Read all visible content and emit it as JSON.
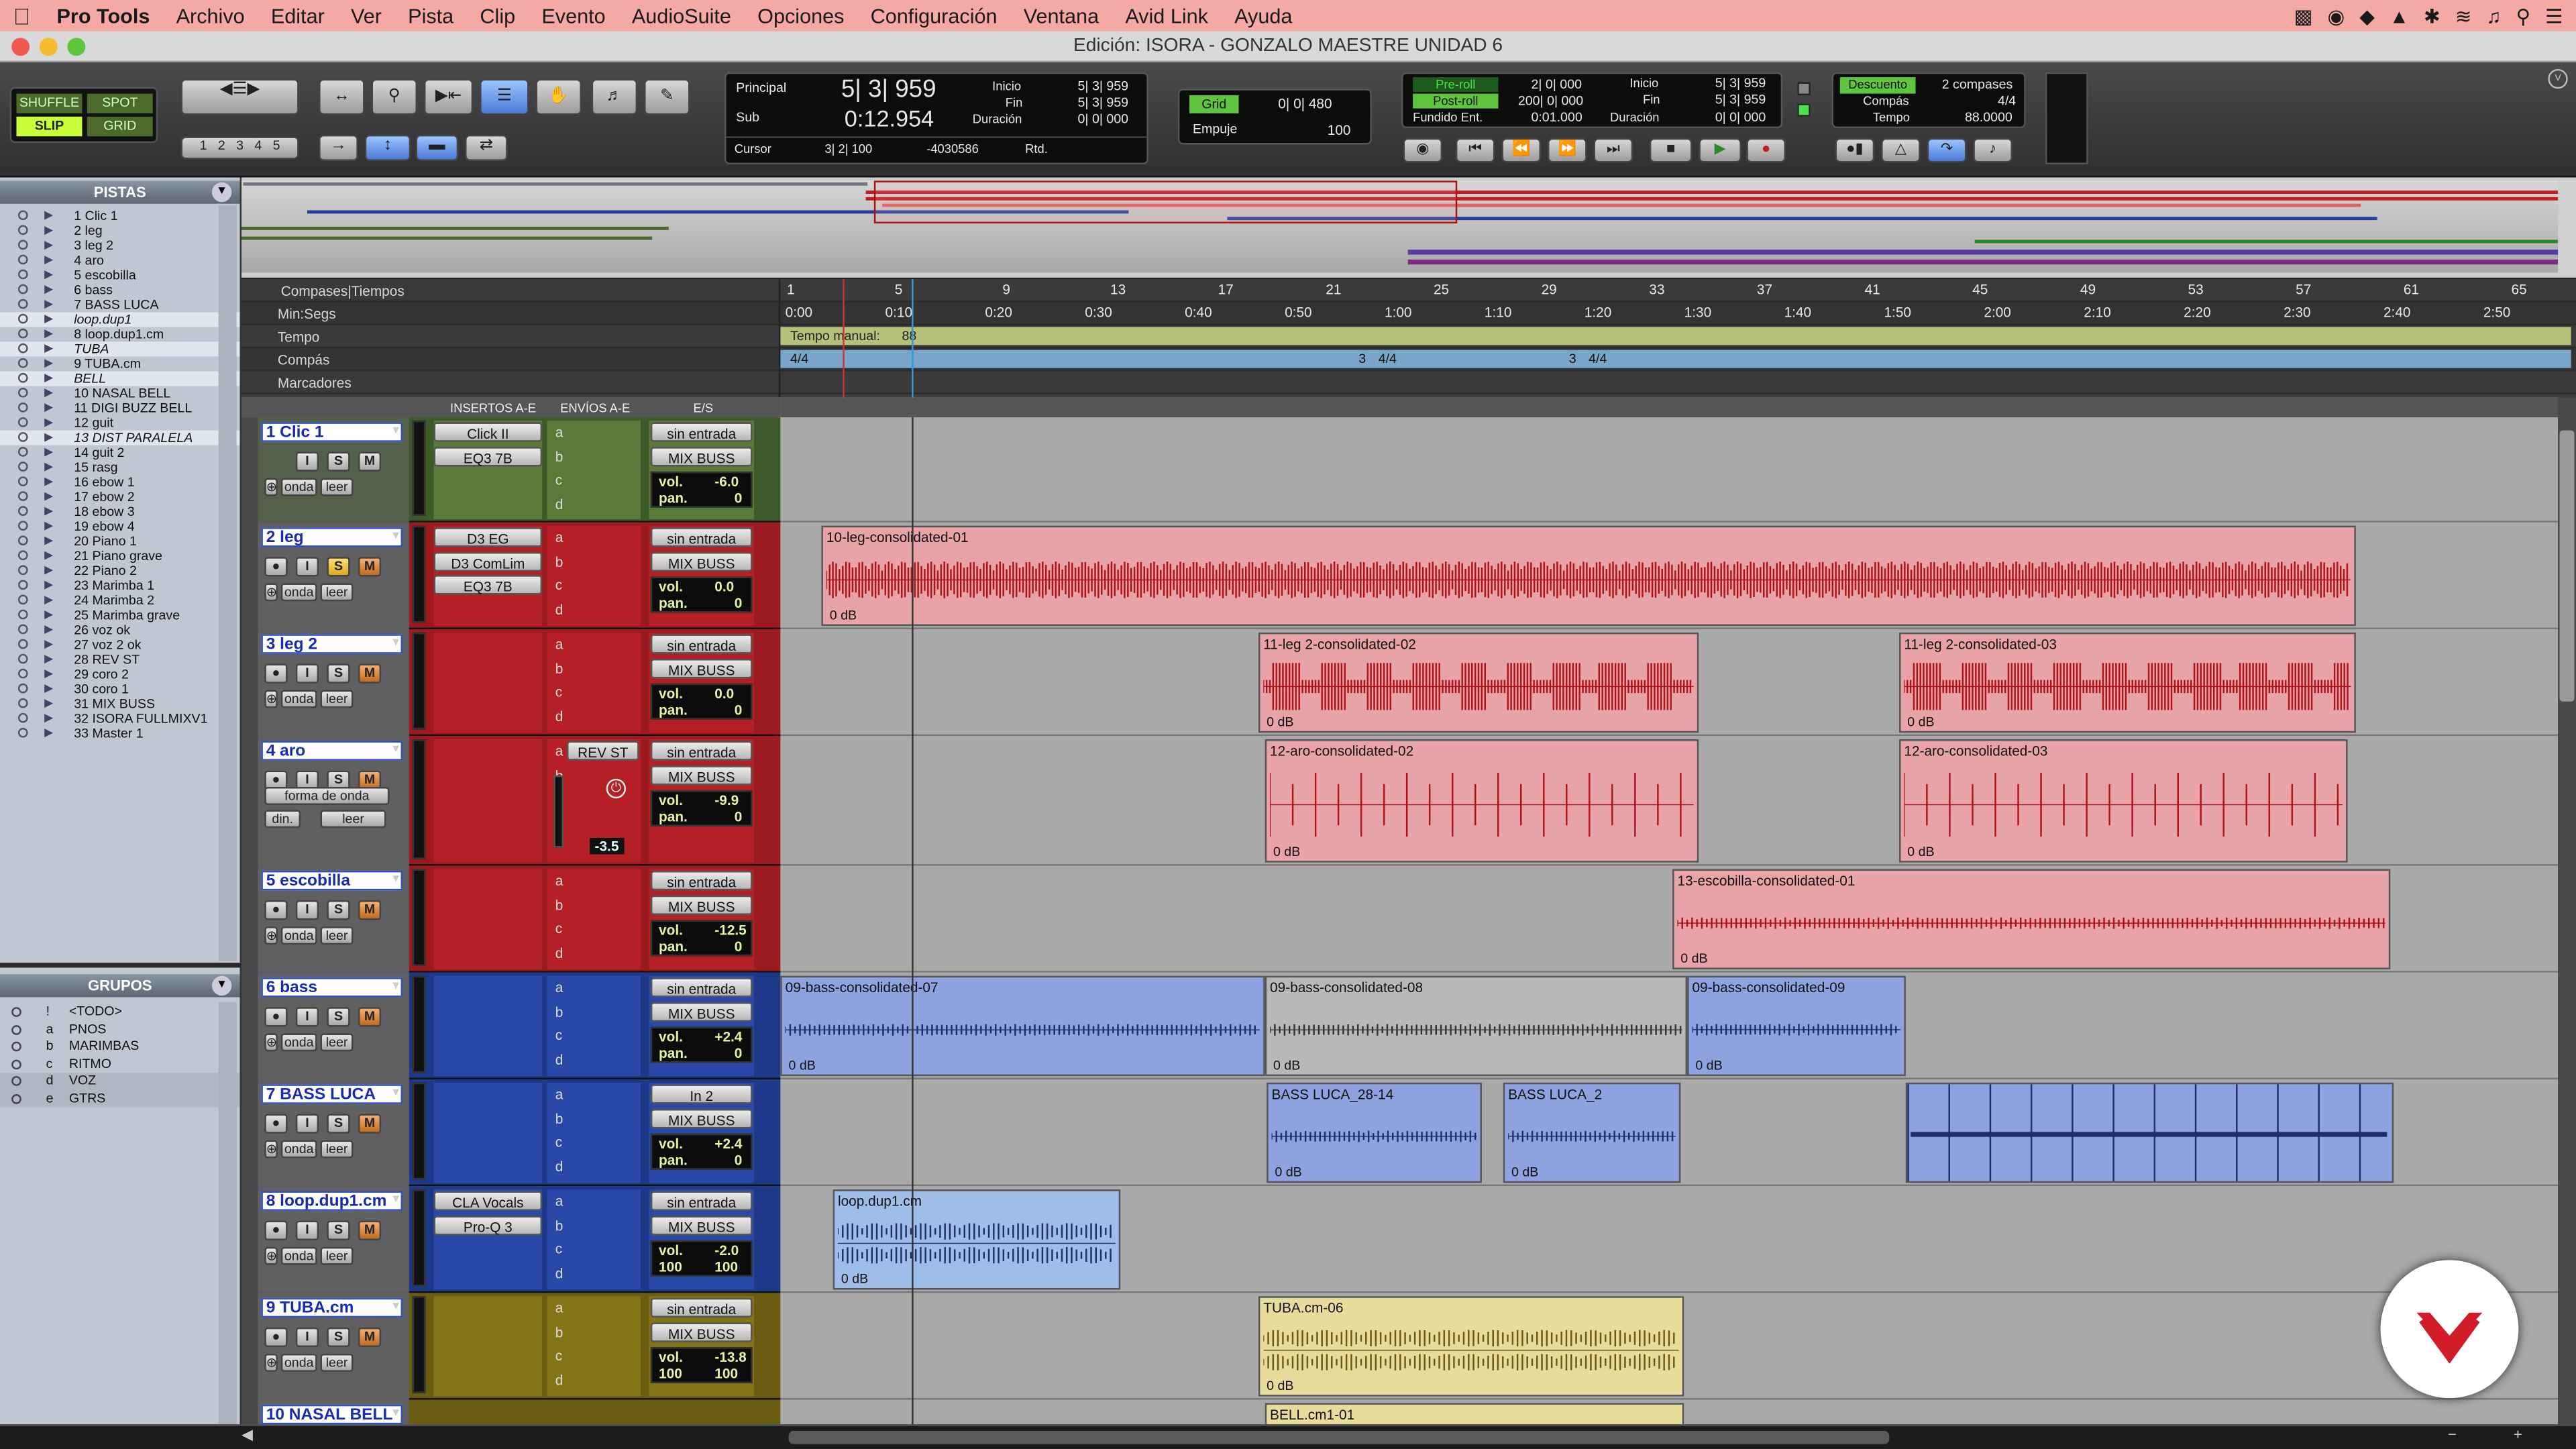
{
  "menubar": {
    "apple": "",
    "app": "Pro Tools",
    "items": [
      "Archivo",
      "Editar",
      "Ver",
      "Pista",
      "Clip",
      "Evento",
      "AudioSuite",
      "Opciones",
      "Configuración",
      "Ventana",
      "Avid Link",
      "Ayuda"
    ]
  },
  "window": {
    "title": "Edición: ISORA - GONZALO MAESTRE UNIDAD 6"
  },
  "toolbar": {
    "modes": {
      "shuffle": "SHUFFLE",
      "spot": "SPOT",
      "slip": "SLIP",
      "grid": "GRID"
    },
    "zoom_presets": [
      "1",
      "2",
      "3",
      "4",
      "5"
    ],
    "counter": {
      "main_label": "Principal",
      "main_value": "5| 3| 959",
      "sub_label": "Sub",
      "sub_value": "0:12.954",
      "cursor_label": "Cursor",
      "cursor_value": "3| 2| 100",
      "cursor_sample": "-4030586",
      "start_label": "Inicio",
      "start_value": "5| 3| 959",
      "end_label": "Fin",
      "end_value": "5| 3| 959",
      "length_label": "Duración",
      "length_value": "0| 0| 000",
      "ritd": "Rtd."
    },
    "grid": {
      "label": "Grid",
      "value": "0| 0| 480",
      "nudge_label": "Empuje",
      "nudge_value": "100"
    },
    "transport": {
      "preroll_label": "Pre-roll",
      "preroll_value": "2| 0| 000",
      "postroll_label": "Post-roll",
      "postroll_value": "200| 0| 000",
      "fade_label": "Fundido Ent.",
      "fade_value": "0:01.000",
      "start_label": "Inicio",
      "start_value": "5| 3| 959",
      "end_label": "Fin",
      "end_value": "5| 3| 959",
      "length_label": "Duración",
      "length_value": "0| 0| 000"
    },
    "countoff": {
      "label": "Descuento",
      "value": "2 compases",
      "meter_label": "Compás",
      "meter_value": "4/4",
      "tempo_label": "Tempo",
      "tempo_value": "88.0000"
    }
  },
  "tracks_panel": {
    "title": "PISTAS",
    "items": [
      {
        "label": "1  Clic 1"
      },
      {
        "label": "2  leg"
      },
      {
        "label": "3  leg 2"
      },
      {
        "label": "4  aro"
      },
      {
        "label": "5  escobilla"
      },
      {
        "label": "6  bass"
      },
      {
        "label": "7  BASS LUCA"
      },
      {
        "label": "loop.dup1",
        "italic": true
      },
      {
        "label": "8  loop.dup1.cm"
      },
      {
        "label": "TUBA",
        "italic": true
      },
      {
        "label": "9  TUBA.cm"
      },
      {
        "label": "BELL",
        "italic": true
      },
      {
        "label": "10  NASAL BELL"
      },
      {
        "label": "11  DIGI BUZZ BELL"
      },
      {
        "label": "12  guit"
      },
      {
        "label": "13  DIST PARALELA",
        "italic": true
      },
      {
        "label": "14  guit 2"
      },
      {
        "label": "15  rasg"
      },
      {
        "label": "16  ebow 1"
      },
      {
        "label": "17  ebow 2"
      },
      {
        "label": "18  ebow 3"
      },
      {
        "label": "19  ebow 4"
      },
      {
        "label": "20  Piano 1"
      },
      {
        "label": "21  Piano grave"
      },
      {
        "label": "22  Piano 2"
      },
      {
        "label": "23  Marimba 1"
      },
      {
        "label": "24  Marimba 2"
      },
      {
        "label": "25  Marimba grave"
      },
      {
        "label": "26  voz ok"
      },
      {
        "label": "27  voz 2 ok"
      },
      {
        "label": "28  REV ST"
      },
      {
        "label": "29  coro 2"
      },
      {
        "label": "30  coro 1"
      },
      {
        "label": "31  MIX BUSS"
      },
      {
        "label": "32  ISORA FULLMIXV1"
      },
      {
        "label": "33  Master 1"
      }
    ]
  },
  "groups_panel": {
    "title": "GRUPOS",
    "items": [
      {
        "id": "!",
        "label": "<TODO>"
      },
      {
        "id": "a",
        "label": "PNOS"
      },
      {
        "id": "b",
        "label": "MARIMBAS"
      },
      {
        "id": "c",
        "label": "RITMO"
      },
      {
        "id": "d",
        "label": "VOZ"
      },
      {
        "id": "e",
        "label": "GTRS"
      }
    ]
  },
  "ruler": {
    "bars_label": "Compases|Tiempos",
    "minsec_label": "Min:Segs",
    "tempo_label": "Tempo",
    "meter_label": "Compás",
    "markers_label": "Marcadores",
    "bar_ticks": [
      "1",
      "5",
      "9",
      "13",
      "17",
      "21",
      "25",
      "29",
      "33",
      "37",
      "41",
      "45",
      "49",
      "53",
      "57",
      "61",
      "65"
    ],
    "time_ticks": [
      "0:00",
      "0:10",
      "0:20",
      "0:30",
      "0:40",
      "0:50",
      "1:00",
      "1:10",
      "1:20",
      "1:30",
      "1:40",
      "1:50",
      "2:00",
      "2:10",
      "2:20",
      "2:30",
      "2:40",
      "2:50"
    ],
    "tempo_text": "Tempo manual:",
    "tempo_value": "88",
    "meter_start": "4/4",
    "meter_change1": "3",
    "meter_change1b": "4/4",
    "meter_change2": "3",
    "meter_change2b": "4/4"
  },
  "col_headers": {
    "inserts": "INSERTOS A-E",
    "sends": "ENVÍOS A-E",
    "io": "E/S"
  },
  "common": {
    "sin_entrada": "sin entrada",
    "mix_buss": "MIX BUSS",
    "vol": "vol.",
    "pan": "pan.",
    "onda": "onda",
    "leer": "leer",
    "db0": "0 dB",
    "forma": "forma de onda",
    "din": "din.",
    "rev": "REV ST",
    "in2": "In 2",
    "m": "M",
    "s": "S",
    "i": "I"
  },
  "tracks": [
    {
      "name": "1  Clic 1",
      "inserts": [
        "Click II",
        "EQ3 7B"
      ],
      "vol": "-6.0",
      "pan": "0"
    },
    {
      "name": "2  leg",
      "inserts": [
        "D3 EG",
        "D3 ComLim",
        "EQ3 7B"
      ],
      "vol": "0.0",
      "pan": "0"
    },
    {
      "name": "3  leg 2",
      "inserts": [],
      "vol": "0.0",
      "pan": "0"
    },
    {
      "name": "4  aro",
      "inserts": [],
      "vol": "-9.9",
      "pan": "0",
      "fader": "-3.5"
    },
    {
      "name": "5  escobilla",
      "inserts": [],
      "vol": "-12.5",
      "pan": "0"
    },
    {
      "name": "6  bass",
      "inserts": [],
      "vol": "+2.4",
      "pan": "0"
    },
    {
      "name": "7  BASS LUCA",
      "inserts": [],
      "vol": "+2.4",
      "pan": "0"
    },
    {
      "name": "8  loop.dup1.cm",
      "inserts": [
        "CLA Vocals",
        "Pro-Q 3"
      ],
      "vol": "-2.0",
      "pan_l": "100",
      "pan_r": "100"
    },
    {
      "name": "9  TUBA.cm",
      "inserts": [],
      "vol": "-13.8",
      "pan_l": "100",
      "pan_r": "100"
    },
    {
      "name": "10  NASAL BELL"
    }
  ],
  "clips": [
    {
      "name": "10-leg-consolidated-01",
      "db": "0 dB"
    },
    {
      "name": "11-leg 2-consolidated-02",
      "db": "0 dB"
    },
    {
      "name": "11-leg 2-consolidated-03",
      "db": "0 dB"
    },
    {
      "name": "12-aro-consolidated-02",
      "db": "0 dB"
    },
    {
      "name": "12-aro-consolidated-03",
      "db": "0 dB"
    },
    {
      "name": "13-escobilla-consolidated-01",
      "db": "0 dB"
    },
    {
      "name": "09-bass-consolidated-07",
      "db": "0 dB"
    },
    {
      "name": "09-bass-consolidated-08",
      "db": "0 dB"
    },
    {
      "name": "09-bass-consolidated-09",
      "db": "0 dB"
    },
    {
      "name": "BASS LUCA_28-14",
      "db": "0 dB"
    },
    {
      "name": "BASS LUCA_2",
      "db": "0 dB"
    },
    {
      "name": "loop.dup1.cm",
      "db": "0 dB"
    },
    {
      "name": "TUBA.cm-06",
      "db": "0 dB"
    },
    {
      "name": "BELL.cm1-01"
    }
  ],
  "colors": {
    "menubar": "#f4a9a6",
    "red_track": "#c11c22",
    "blue_track": "#24409a",
    "olive_track": "#7a6a14",
    "clip_red": "#e7a3a8",
    "clip_blue": "#8ea2e0",
    "clip_yellow": "#e8dc9c"
  }
}
